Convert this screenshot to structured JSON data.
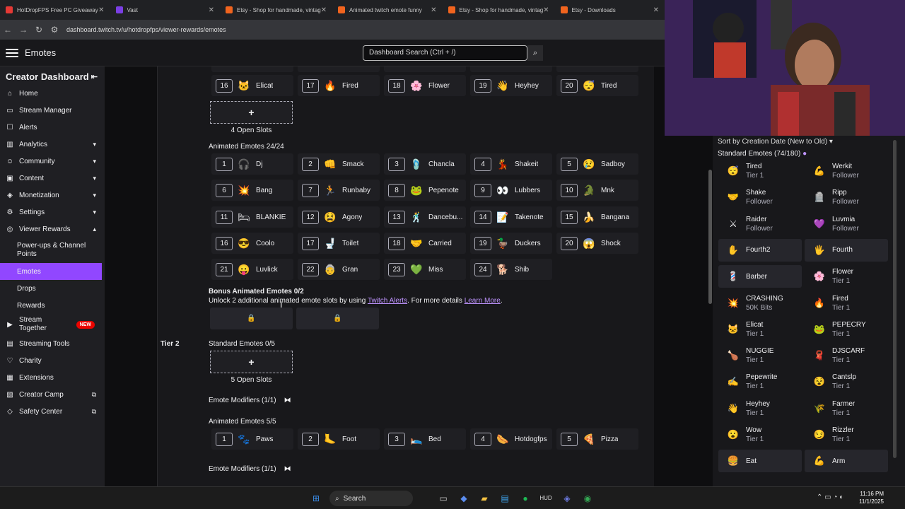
{
  "browser": {
    "tabs": [
      {
        "title": "HotDropFPS Free PC Giveaway",
        "color": "#e53935"
      },
      {
        "title": "Vast",
        "color": "#7b3fe4"
      },
      {
        "title": "Etsy - Shop for handmade, vintage",
        "color": "#f1641e"
      },
      {
        "title": "Animated twitch emote funny",
        "color": "#f1641e"
      },
      {
        "title": "Etsy - Shop for handmade, vintage",
        "color": "#f1641e"
      },
      {
        "title": "Etsy - Downloads",
        "color": "#f1641e"
      }
    ],
    "url": "dashboard.twitch.tv/u/hotdropfps/viewer-rewards/emotes"
  },
  "header": {
    "title": "Emotes",
    "search_placeholder": "Dashboard Search (Ctrl + /)"
  },
  "sidebar": {
    "title": "Creator Dashboard",
    "items": [
      {
        "label": "Home",
        "icon": "⌂"
      },
      {
        "label": "Stream Manager",
        "icon": "▭"
      },
      {
        "label": "Alerts",
        "icon": "☐"
      },
      {
        "label": "Analytics",
        "icon": "▥"
      },
      {
        "label": "Community",
        "icon": "☺"
      },
      {
        "label": "Content",
        "icon": "▣"
      },
      {
        "label": "Monetization",
        "icon": "◈"
      },
      {
        "label": "Settings",
        "icon": "⚙"
      },
      {
        "label": "Viewer Rewards",
        "icon": "◎"
      }
    ],
    "subitems": [
      "Power-ups & Channel Points",
      "Emotes",
      "Drops",
      "Rewards"
    ],
    "items2": [
      {
        "label": "Stream Together",
        "icon": "▶",
        "badge": "NEW"
      },
      {
        "label": "Streaming Tools",
        "icon": "▤"
      },
      {
        "label": "Charity",
        "icon": "♡"
      },
      {
        "label": "Extensions",
        "icon": "▦"
      },
      {
        "label": "Creator Camp",
        "icon": "▧"
      },
      {
        "label": "Safety Center",
        "icon": "◇"
      }
    ]
  },
  "tier1_static_row": [
    {
      "num": "16",
      "name": "Elicat",
      "icon": "🐱"
    },
    {
      "num": "17",
      "name": "Fired",
      "icon": "🔥"
    },
    {
      "num": "18",
      "name": "Flower",
      "icon": "🌸"
    },
    {
      "num": "19",
      "name": "Heyhey",
      "icon": "👋"
    },
    {
      "num": "20",
      "name": "Tired",
      "icon": "😴"
    }
  ],
  "open_slots_1": "4 Open Slots",
  "animated_title": "Animated Emotes 24/24",
  "animated": [
    {
      "num": "1",
      "name": "Dj",
      "icon": "🎧"
    },
    {
      "num": "2",
      "name": "Smack",
      "icon": "👊"
    },
    {
      "num": "3",
      "name": "Chancla",
      "icon": "🩴"
    },
    {
      "num": "4",
      "name": "Shakeit",
      "icon": "💃"
    },
    {
      "num": "5",
      "name": "Sadboy",
      "icon": "😢"
    },
    {
      "num": "6",
      "name": "Bang",
      "icon": "💥"
    },
    {
      "num": "7",
      "name": "Runbaby",
      "icon": "🏃"
    },
    {
      "num": "8",
      "name": "Pepenote",
      "icon": "🐸"
    },
    {
      "num": "9",
      "name": "Lubbers",
      "icon": "👀"
    },
    {
      "num": "10",
      "name": "Mnk",
      "icon": "🐊"
    },
    {
      "num": "11",
      "name": "BLANKIE",
      "icon": "🛏"
    },
    {
      "num": "12",
      "name": "Agony",
      "icon": "😫"
    },
    {
      "num": "13",
      "name": "Dancebu...",
      "icon": "🕺"
    },
    {
      "num": "14",
      "name": "Takenote",
      "icon": "📝"
    },
    {
      "num": "15",
      "name": "Bangana",
      "icon": "🍌"
    },
    {
      "num": "16",
      "name": "Coolo",
      "icon": "😎"
    },
    {
      "num": "17",
      "name": "Toilet",
      "icon": "🚽"
    },
    {
      "num": "18",
      "name": "Carried",
      "icon": "🤝"
    },
    {
      "num": "19",
      "name": "Duckers",
      "icon": "🦆"
    },
    {
      "num": "20",
      "name": "Shock",
      "icon": "😱"
    },
    {
      "num": "21",
      "name": "Luvlick",
      "icon": "😛"
    },
    {
      "num": "22",
      "name": "Gran",
      "icon": "👵"
    },
    {
      "num": "23",
      "name": "Miss",
      "icon": "💚"
    },
    {
      "num": "24",
      "name": "Shib",
      "icon": "🐕"
    }
  ],
  "bonus": {
    "title": "Bonus Animated Emotes 0/2",
    "text": "Unlock 2 additional animated emote slots by using ",
    "link1": "Twitch Alerts",
    "text2": ". For more details ",
    "link2": "Learn More",
    "text3": "."
  },
  "tier2": {
    "label": "Tier 2",
    "standard_title": "Standard Emotes 0/5",
    "open_slots": "5 Open Slots",
    "modifiers": "Emote Modifiers (1/1)",
    "animated_title": "Animated Emotes 5/5",
    "animated": [
      {
        "num": "1",
        "name": "Paws",
        "icon": "🐾"
      },
      {
        "num": "2",
        "name": "Foot",
        "icon": "🦶"
      },
      {
        "num": "3",
        "name": "Bed",
        "icon": "🛌"
      },
      {
        "num": "4",
        "name": "Hotdogfps",
        "icon": "🌭"
      },
      {
        "num": "5",
        "name": "Pizza",
        "icon": "🍕"
      }
    ],
    "modifiers2": "Emote Modifiers (1/1)"
  },
  "right_panel": {
    "sort_text": "Sort by  Creation Date (New to Old) ▾",
    "title": "Standard Emotes (74/180)",
    "items": [
      {
        "name": "Tired",
        "sub": "Tier 1",
        "icon": "😴"
      },
      {
        "name": "Werkit",
        "sub": "Follower",
        "icon": "💪"
      },
      {
        "name": "Shake",
        "sub": "Follower",
        "icon": "🤝"
      },
      {
        "name": "Ripp",
        "sub": "Follower",
        "icon": "🪦"
      },
      {
        "name": "Raider",
        "sub": "Follower",
        "icon": "⚔"
      },
      {
        "name": "Luvmia",
        "sub": "Follower",
        "icon": "💜"
      },
      {
        "name": "Fourth2",
        "sub": "",
        "icon": "✋"
      },
      {
        "name": "Fourth",
        "sub": "",
        "icon": "🖐"
      },
      {
        "name": "Barber",
        "sub": "",
        "icon": "💈"
      },
      {
        "name": "Flower",
        "sub": "Tier 1",
        "icon": "🌸"
      },
      {
        "name": "CRASHING",
        "sub": "50K Bits",
        "icon": "💥"
      },
      {
        "name": "Fired",
        "sub": "Tier 1",
        "icon": "🔥"
      },
      {
        "name": "Elicat",
        "sub": "Tier 1",
        "icon": "🐱"
      },
      {
        "name": "PEPECRY",
        "sub": "Tier 1",
        "icon": "🐸"
      },
      {
        "name": "NUGGIE",
        "sub": "Tier 1",
        "icon": "🍗"
      },
      {
        "name": "DJSCARF",
        "sub": "Tier 1",
        "icon": "🧣"
      },
      {
        "name": "Pepewrite",
        "sub": "Tier 1",
        "icon": "✍"
      },
      {
        "name": "Cantslp",
        "sub": "Tier 1",
        "icon": "😵"
      },
      {
        "name": "Heyhey",
        "sub": "Tier 1",
        "icon": "👋"
      },
      {
        "name": "Farmer",
        "sub": "Tier 1",
        "icon": "🌾"
      },
      {
        "name": "Wow",
        "sub": "Tier 1",
        "icon": "😮"
      },
      {
        "name": "Rizzler",
        "sub": "Tier 1",
        "icon": "😏"
      },
      {
        "name": "Eat",
        "sub": "",
        "icon": "🍔"
      },
      {
        "name": "Arm",
        "sub": "",
        "icon": "💪"
      }
    ]
  },
  "taskbar": {
    "search": "Search",
    "time": "11:16 PM",
    "date": "11/1/2025"
  }
}
